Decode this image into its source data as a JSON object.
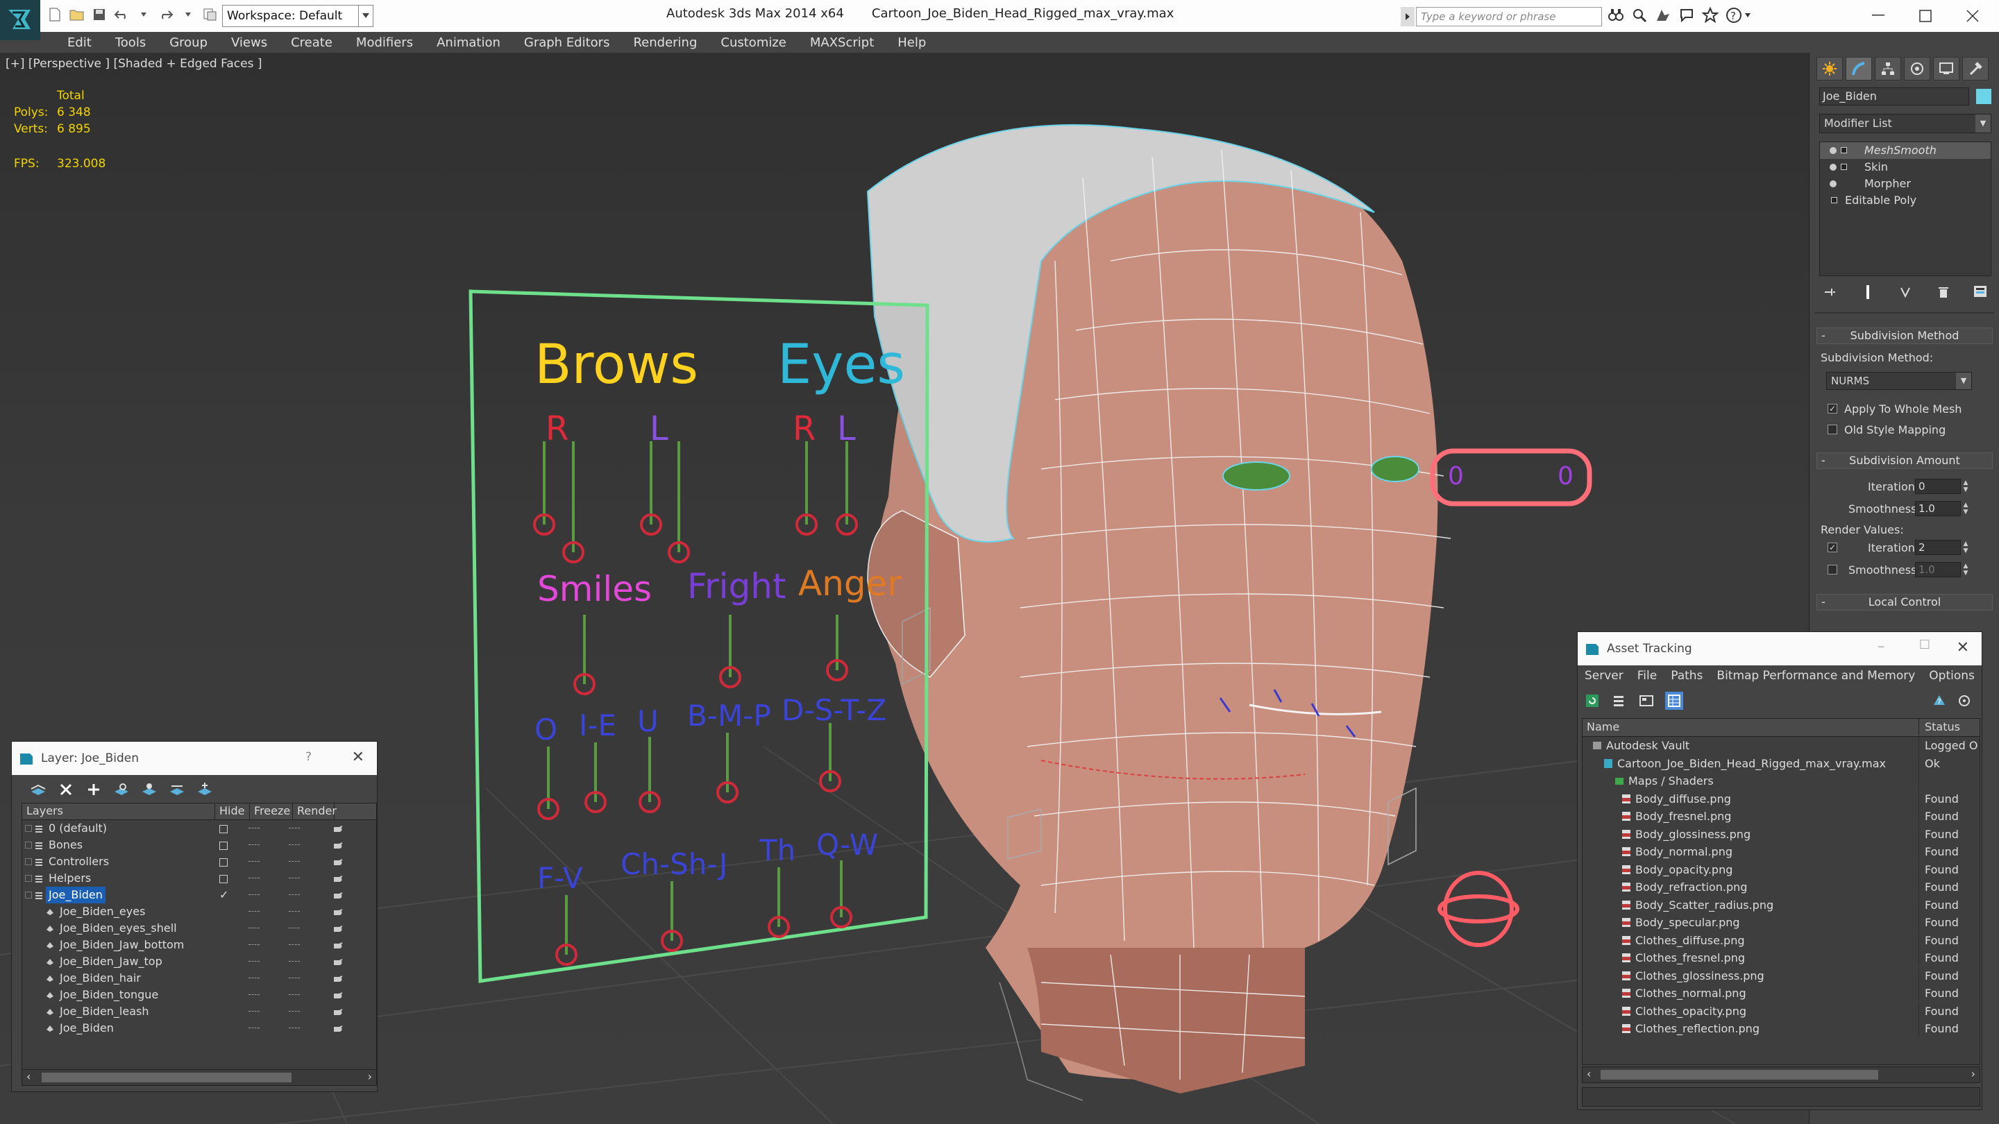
{
  "app": {
    "title": "Autodesk 3ds Max  2014 x64",
    "filename": "Cartoon_Joe_Biden_Head_Rigged_max_vray.max",
    "workspace": "Workspace: Default",
    "search_placeholder": "Type a keyword or phrase"
  },
  "menu": [
    "Edit",
    "Tools",
    "Group",
    "Views",
    "Create",
    "Modifiers",
    "Animation",
    "Graph Editors",
    "Rendering",
    "Customize",
    "MAXScript",
    "Help"
  ],
  "viewport": {
    "label": "[+] [Perspective ] [Shaded + Edged Faces ]",
    "stats": {
      "header": "Total",
      "polys_label": "Polys:",
      "polys": "6 348",
      "verts_label": "Verts:",
      "verts": "6 895",
      "fps_label": "FPS:",
      "fps": "323.008"
    },
    "rig_board": {
      "brows": "Brows",
      "eyes": "Eyes",
      "brow_r": "R",
      "brow_l": "L",
      "eye_r": "R",
      "eye_l": "L",
      "smiles": "Smiles",
      "fright": "Fright",
      "anger": "Anger",
      "o": "O",
      "ie": "I-E",
      "u": "U",
      "bmp": "B-M-P",
      "dstz": "D-S-T-Z",
      "fv": "F-V",
      "chshj": "Ch-Sh-J",
      "th": "Th",
      "qw": "Q-W"
    },
    "eye_ctrl": {
      "left": "0",
      "right": "0"
    }
  },
  "command_panel": {
    "object_name": "Joe_Biden",
    "modifier_list": "Modifier List",
    "stack": [
      "MeshSmooth",
      "Skin",
      "Morpher",
      "Editable Poly"
    ],
    "subdivision_method": {
      "title": "Subdivision Method",
      "label": "Subdivision Method:",
      "value": "NURMS",
      "apply_whole_mesh": "Apply To Whole Mesh",
      "old_style": "Old Style Mapping"
    },
    "subdivision_amount": {
      "title": "Subdivision Amount",
      "iterations_label": "Iterations:",
      "iterations": "0",
      "smoothness_label": "Smoothness:",
      "smoothness": "1.0",
      "render_values": "Render Values:",
      "r_iterations_label": "Iterations:",
      "r_iterations": "2",
      "r_smoothness_label": "Smoothness:",
      "r_smoothness": "1.0"
    },
    "local_control": "Local Control"
  },
  "layer_window": {
    "title": "Layer: Joe_Biden",
    "help": "?",
    "columns": [
      "Layers",
      "Hide",
      "Freeze",
      "Render"
    ],
    "rows": [
      {
        "name": "0 (default)",
        "indent": 0
      },
      {
        "name": "Bones",
        "indent": 0
      },
      {
        "name": "Controllers",
        "indent": 0
      },
      {
        "name": "Helpers",
        "indent": 0
      },
      {
        "name": "Joe_Biden",
        "indent": 0
      },
      {
        "name": "Joe_Biden_eyes",
        "indent": 1
      },
      {
        "name": "Joe_Biden_eyes_shell",
        "indent": 1
      },
      {
        "name": "Joe_Biden_Jaw_bottom",
        "indent": 1
      },
      {
        "name": "Joe_Biden_Jaw_top",
        "indent": 1
      },
      {
        "name": "Joe_Biden_hair",
        "indent": 1
      },
      {
        "name": "Joe_Biden_tongue",
        "indent": 1
      },
      {
        "name": "Joe_Biden_leash",
        "indent": 1
      },
      {
        "name": "Joe_Biden",
        "indent": 1
      }
    ]
  },
  "asset_window": {
    "title": "Asset Tracking",
    "menu": [
      "Server",
      "File",
      "Paths",
      "Bitmap Performance and Memory",
      "Options"
    ],
    "columns": [
      "Name",
      "Status"
    ],
    "rows": [
      {
        "name": "Autodesk Vault",
        "status": "Logged O",
        "level": 0
      },
      {
        "name": "Cartoon_Joe_Biden_Head_Rigged_max_vray.max",
        "status": "Ok",
        "level": 1
      },
      {
        "name": "Maps / Shaders",
        "status": "",
        "level": 2
      },
      {
        "name": "Body_diffuse.png",
        "status": "Found",
        "level": 3
      },
      {
        "name": "Body_fresnel.png",
        "status": "Found",
        "level": 3
      },
      {
        "name": "Body_glossiness.png",
        "status": "Found",
        "level": 3
      },
      {
        "name": "Body_normal.png",
        "status": "Found",
        "level": 3
      },
      {
        "name": "Body_opacity.png",
        "status": "Found",
        "level": 3
      },
      {
        "name": "Body_refraction.png",
        "status": "Found",
        "level": 3
      },
      {
        "name": "Body_Scatter_radius.png",
        "status": "Found",
        "level": 3
      },
      {
        "name": "Body_specular.png",
        "status": "Found",
        "level": 3
      },
      {
        "name": "Clothes_diffuse.png",
        "status": "Found",
        "level": 3
      },
      {
        "name": "Clothes_fresnel.png",
        "status": "Found",
        "level": 3
      },
      {
        "name": "Clothes_glossiness.png",
        "status": "Found",
        "level": 3
      },
      {
        "name": "Clothes_normal.png",
        "status": "Found",
        "level": 3
      },
      {
        "name": "Clothes_opacity.png",
        "status": "Found",
        "level": 3
      },
      {
        "name": "Clothes_reflection.png",
        "status": "Found",
        "level": 3
      }
    ]
  },
  "colors": {
    "stats_yellow": "#f2d400",
    "selection_blue": "#1a5fb4",
    "wire_cyan": "#6cd4e8",
    "board_green": "#6ee08c"
  }
}
